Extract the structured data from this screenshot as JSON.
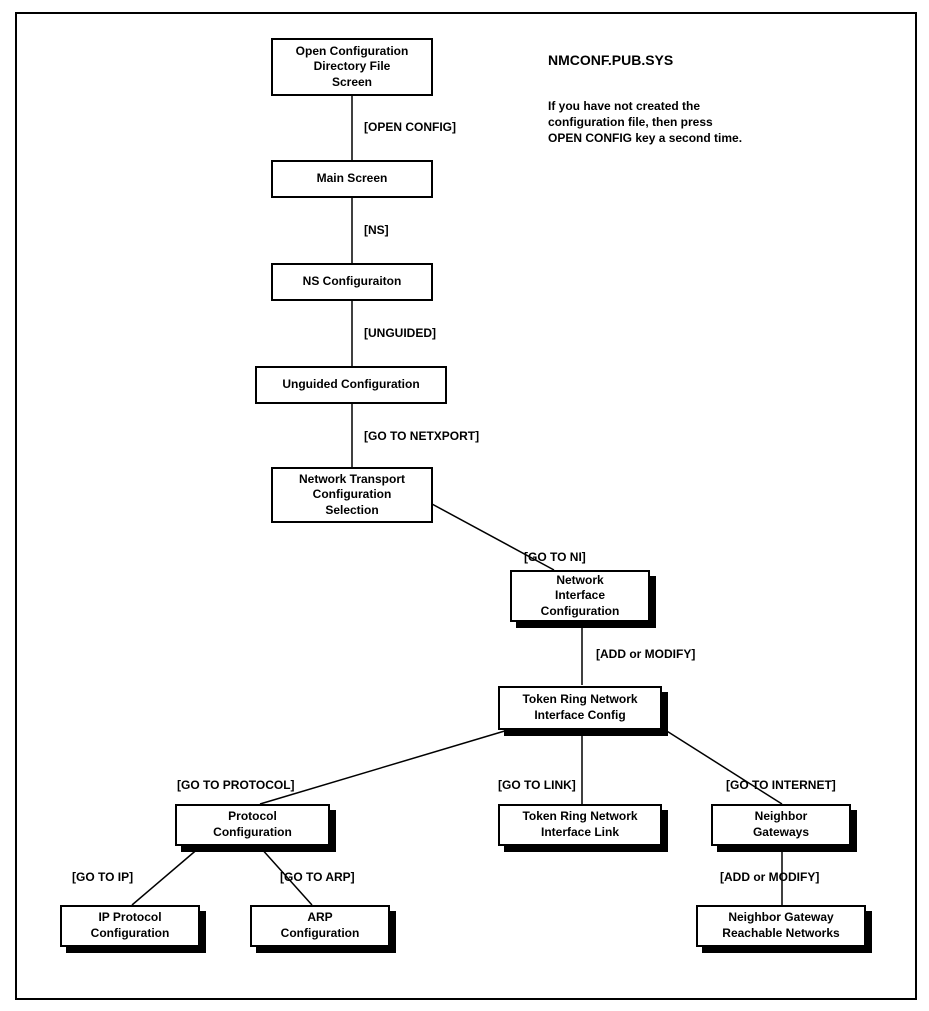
{
  "annotation": {
    "title": "NMCONF.PUB.SYS",
    "body_l1": "If you have not created the",
    "body_l2": "configuration file, then press",
    "body_l3": "OPEN CONFIG key a second time."
  },
  "nodes": {
    "open_config_dir": "Open Configuration\nDirectory File\nScreen",
    "main_screen": "Main Screen",
    "ns_config": "NS Configuraiton",
    "unguided": "Unguided Configuration",
    "netxport": "Network Transport\nConfiguration\nSelection",
    "ni_config": "Network\nInterface\nConfiguration",
    "tr_iface_config": "Token Ring Network\nInterface Config",
    "protocol_config": "Protocol\nConfiguration",
    "ip_protocol": "IP Protocol\nConfiguration",
    "arp_config": "ARP\nConfiguration",
    "tr_iface_link": "Token Ring Network\nInterface Link",
    "neighbor_gw": "Neighbor\nGateways",
    "neighbor_gw_reach": "Neighbor Gateway\nReachable Networks"
  },
  "edges": {
    "open_config": "[OPEN CONFIG]",
    "ns": "[NS]",
    "unguided": "[UNGUIDED]",
    "go_netxport": "[GO TO NETXPORT]",
    "go_ni": "[GO TO NI]",
    "add_modify1": "[ADD or MODIFY]",
    "go_protocol": "[GO TO PROTOCOL]",
    "go_link": "[GO TO LINK]",
    "go_internet": "[GO TO INTERNET]",
    "go_ip": "[GO TO IP]",
    "go_arp": "[GO TO ARP]",
    "add_modify2": "[ADD or MODIFY]"
  }
}
